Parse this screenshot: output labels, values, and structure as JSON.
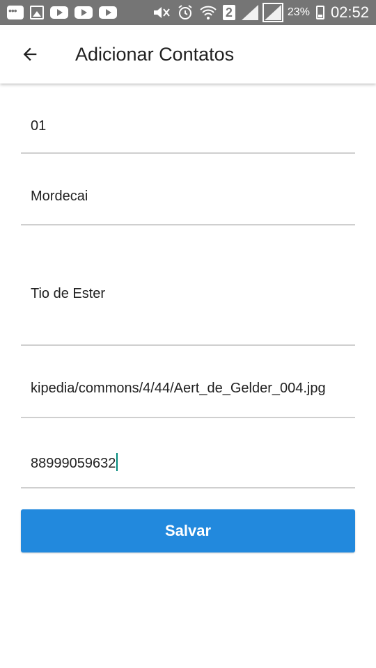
{
  "status_bar": {
    "icons": [
      "chat-icon",
      "image-icon",
      "youtube-icon",
      "youtube-icon",
      "youtube-icon",
      "mute-icon",
      "alarm-icon",
      "wifi-icon",
      "sim-2-icon",
      "signal-icon",
      "signal-icon",
      "battery-charging-icon"
    ],
    "sim_label": "2",
    "battery": "23%",
    "time": "02:52"
  },
  "app_bar": {
    "back_icon": "arrow-left-icon",
    "title": "Adicionar Contatos"
  },
  "form": {
    "fields": [
      {
        "value": "01"
      },
      {
        "value": "Mordecai"
      },
      {
        "value": "Tio de Ester"
      },
      {
        "value": "kipedia/commons/4/44/Aert_de_Gelder_004.jpg"
      },
      {
        "value": "88999059632",
        "focused": true
      }
    ],
    "save_label": "Salvar"
  },
  "colors": {
    "status_bar": "#757575",
    "accent": "#2289dd",
    "divider": "#cfcfcf",
    "caret": "#00897b"
  }
}
